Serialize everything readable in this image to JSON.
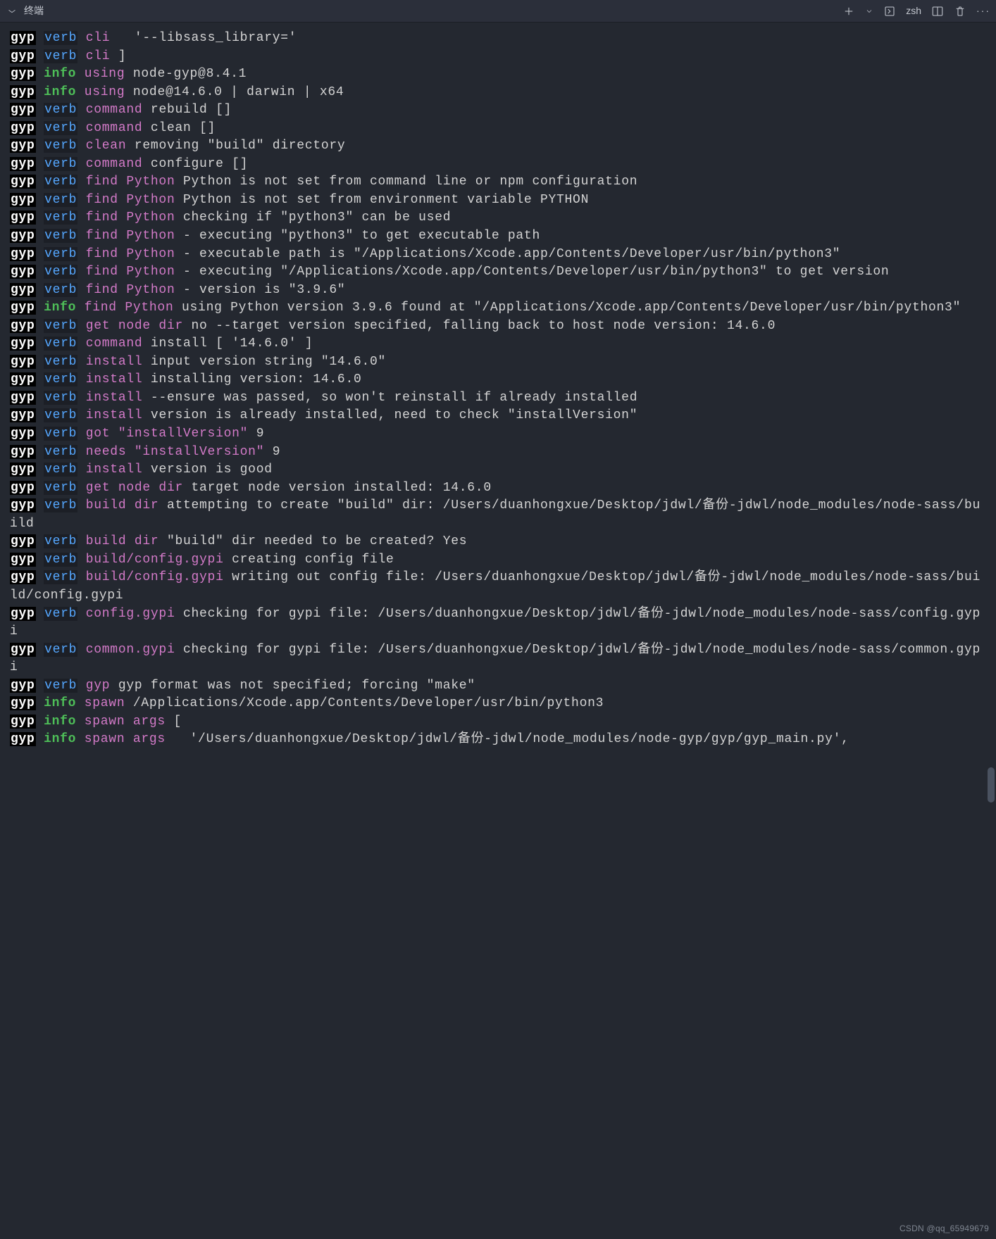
{
  "header": {
    "title": "终端",
    "shell": "zsh"
  },
  "watermark": "CSDN @qq_65949679",
  "lines": [
    {
      "p": "gyp",
      "l": "verb",
      "c": "cli",
      "m": "  '--libsass_library='"
    },
    {
      "p": "gyp",
      "l": "verb",
      "c": "cli",
      "m": "]"
    },
    {
      "p": "gyp",
      "l": "info",
      "c": "using",
      "m": "node-gyp@8.4.1"
    },
    {
      "p": "gyp",
      "l": "info",
      "c": "using",
      "m": "node@14.6.0 | darwin | x64"
    },
    {
      "p": "gyp",
      "l": "verb",
      "c": "command",
      "m": "rebuild []"
    },
    {
      "p": "gyp",
      "l": "verb",
      "c": "command",
      "m": "clean []"
    },
    {
      "p": "gyp",
      "l": "verb",
      "c": "clean",
      "m": "removing \"build\" directory"
    },
    {
      "p": "gyp",
      "l": "verb",
      "c": "command",
      "m": "configure []"
    },
    {
      "p": "gyp",
      "l": "verb",
      "c": "find Python",
      "m": "Python is not set from command line or npm configuration"
    },
    {
      "p": "gyp",
      "l": "verb",
      "c": "find Python",
      "m": "Python is not set from environment variable PYTHON"
    },
    {
      "p": "gyp",
      "l": "verb",
      "c": "find Python",
      "m": "checking if \"python3\" can be used"
    },
    {
      "p": "gyp",
      "l": "verb",
      "c": "find Python",
      "m": "- executing \"python3\" to get executable path"
    },
    {
      "p": "gyp",
      "l": "verb",
      "c": "find Python",
      "m": "- executable path is \"/Applications/Xcode.app/Contents/Developer/usr/bin/python3\""
    },
    {
      "p": "gyp",
      "l": "verb",
      "c": "find Python",
      "m": "- executing \"/Applications/Xcode.app/Contents/Developer/usr/bin/python3\" to get version"
    },
    {
      "p": "gyp",
      "l": "verb",
      "c": "find Python",
      "m": "- version is \"3.9.6\""
    },
    {
      "p": "gyp",
      "l": "info",
      "c": "find Python",
      "m": "using Python version 3.9.6 found at \"/Applications/Xcode.app/Contents/Developer/usr/bin/python3\""
    },
    {
      "p": "gyp",
      "l": "verb",
      "c": "get node dir",
      "m": "no --target version specified, falling back to host node version: 14.6.0"
    },
    {
      "p": "gyp",
      "l": "verb",
      "c": "command",
      "m": "install [ '14.6.0' ]"
    },
    {
      "p": "gyp",
      "l": "verb",
      "c": "install",
      "m": "input version string \"14.6.0\""
    },
    {
      "p": "gyp",
      "l": "verb",
      "c": "install",
      "m": "installing version: 14.6.0"
    },
    {
      "p": "gyp",
      "l": "verb",
      "c": "install",
      "m": "--ensure was passed, so won't reinstall if already installed"
    },
    {
      "p": "gyp",
      "l": "verb",
      "c": "install",
      "m": "version is already installed, need to check \"installVersion\""
    },
    {
      "p": "gyp",
      "l": "verb",
      "c": "got \"installVersion\"",
      "m": "9"
    },
    {
      "p": "gyp",
      "l": "verb",
      "c": "needs \"installVersion\"",
      "m": "9"
    },
    {
      "p": "gyp",
      "l": "verb",
      "c": "install",
      "m": "version is good"
    },
    {
      "p": "gyp",
      "l": "verb",
      "c": "get node dir",
      "m": "target node version installed: 14.6.0"
    },
    {
      "p": "gyp",
      "l": "verb",
      "c": "build dir",
      "m": "attempting to create \"build\" dir: /Users/duanhongxue/Desktop/jdwl/备份-jdwl/node_modules/node-sass/build"
    },
    {
      "p": "gyp",
      "l": "verb",
      "c": "build dir",
      "m": "\"build\" dir needed to be created? Yes"
    },
    {
      "p": "gyp",
      "l": "verb",
      "c": "build/config.gypi",
      "m": "creating config file"
    },
    {
      "p": "gyp",
      "l": "verb",
      "c": "build/config.gypi",
      "m": "writing out config file: /Users/duanhongxue/Desktop/jdwl/备份-jdwl/node_modules/node-sass/build/config.gypi"
    },
    {
      "p": "gyp",
      "l": "verb",
      "c": "config.gypi",
      "m": "checking for gypi file: /Users/duanhongxue/Desktop/jdwl/备份-jdwl/node_modules/node-sass/config.gypi"
    },
    {
      "p": "gyp",
      "l": "verb",
      "c": "common.gypi",
      "m": "checking for gypi file: /Users/duanhongxue/Desktop/jdwl/备份-jdwl/node_modules/node-sass/common.gypi"
    },
    {
      "p": "gyp",
      "l": "verb",
      "c": "gyp",
      "m": "gyp format was not specified; forcing \"make\""
    },
    {
      "p": "gyp",
      "l": "info",
      "c": "spawn",
      "m": "/Applications/Xcode.app/Contents/Developer/usr/bin/python3"
    },
    {
      "p": "gyp",
      "l": "info",
      "c": "spawn args",
      "m": "["
    },
    {
      "p": "gyp",
      "l": "info",
      "c": "spawn args",
      "m": "  '/Users/duanhongxue/Desktop/jdwl/备份-jdwl/node_modules/node-gyp/gyp/gyp_main.py',"
    }
  ]
}
